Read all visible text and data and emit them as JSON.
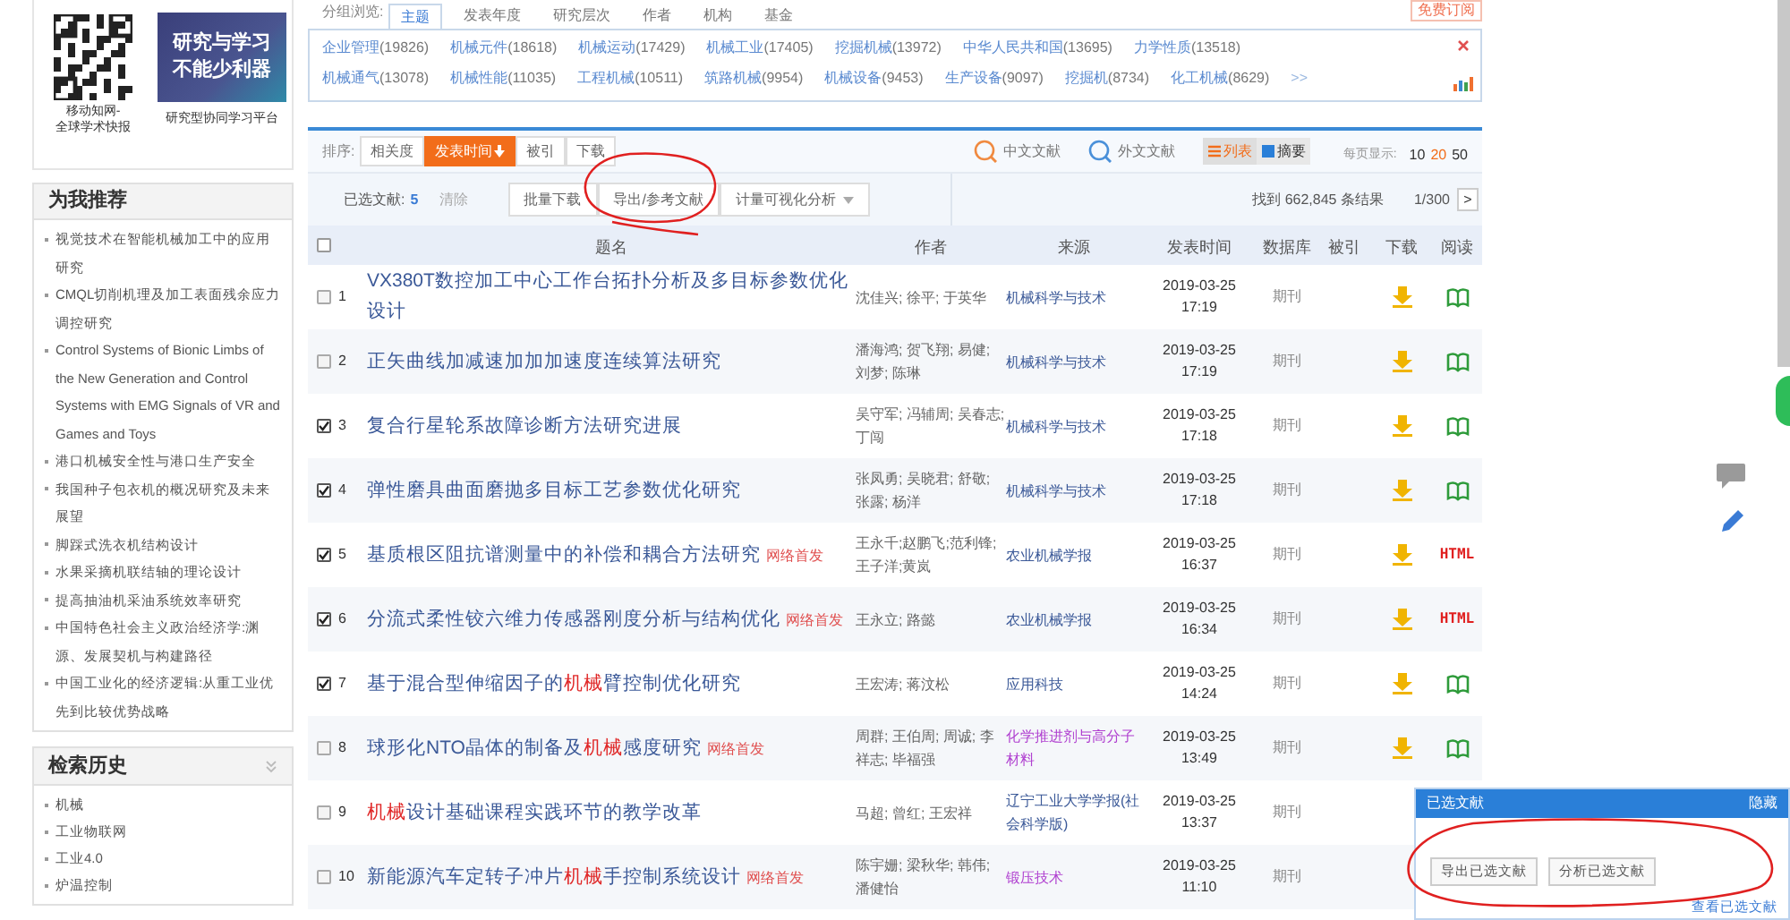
{
  "promo": {
    "qr_caption": "移动知网-\n全球学术快报",
    "banner_lines": [
      "研究与学习",
      "不能少利器"
    ],
    "banner_caption": "研究型协同学习平台"
  },
  "group_browse": {
    "label": "分组浏览:",
    "tabs": [
      {
        "label": "主题",
        "selected": true
      },
      {
        "label": "发表年度",
        "selected": false
      },
      {
        "label": "研究层次",
        "selected": false
      },
      {
        "label": "作者",
        "selected": false
      },
      {
        "label": "机构",
        "selected": false
      },
      {
        "label": "基金",
        "selected": false
      }
    ],
    "subscribe": "免费订阅",
    "more": ">>",
    "topic_rows": [
      [
        {
          "name": "企业管理",
          "count": "(19826)"
        },
        {
          "name": "机械元件",
          "count": "(18618)"
        },
        {
          "name": "机械运动",
          "count": "(17429)"
        },
        {
          "name": "机械工业",
          "count": "(17405)"
        },
        {
          "name": "挖掘机械",
          "count": "(13972)"
        },
        {
          "name": "中华人民共和国",
          "count": "(13695)"
        },
        {
          "name": "力学性质",
          "count": "(13518)"
        }
      ],
      [
        {
          "name": "机械通气",
          "count": "(13078)"
        },
        {
          "name": "机械性能",
          "count": "(11035)"
        },
        {
          "name": "工程机械",
          "count": "(10511)"
        },
        {
          "name": "筑路机械",
          "count": "(9954)"
        },
        {
          "name": "机械设备",
          "count": "(9453)"
        },
        {
          "name": "生产设备",
          "count": "(9097)"
        },
        {
          "name": "挖掘机",
          "count": "(8734)"
        },
        {
          "name": "化工机械",
          "count": "(8629)"
        }
      ]
    ]
  },
  "sidebar": {
    "recommend": {
      "title": "为我推荐",
      "items": [
        "视觉技术在智能机械加工中的应用研究",
        "CMQL切削机理及加工表面残余应力调控研究",
        "Control Systems of Bionic Limbs of the New Generation and Control Systems with EMG Signals of VR and Games and Toys",
        "港口机械安全性与港口生产安全",
        "我国种子包衣机的概况研究及未来展望",
        "脚踩式洗衣机结构设计",
        "水果采摘机联结轴的理论设计",
        "提高抽油机采油系统效率研究",
        "中国特色社会主义政治经济学:渊源、发展契机与构建路径",
        "中国工业化的经济逻辑:从重工业优先到比较优势战略"
      ]
    },
    "history": {
      "title": "检索历史",
      "expanded": false,
      "items": [
        "机械",
        "工业物联网",
        "工业4.0",
        "炉温控制"
      ]
    }
  },
  "sort_bar": {
    "label": "排序:",
    "options": [
      {
        "label": "相关度",
        "selected": false
      },
      {
        "label": "发表时间",
        "selected": true
      },
      {
        "label": "被引",
        "selected": false
      },
      {
        "label": "下载",
        "selected": false
      }
    ],
    "chinese": "中文文献",
    "foreign": "外文文献",
    "views": [
      {
        "label": "列表",
        "selected": true
      },
      {
        "label": "摘要",
        "selected": false
      }
    ],
    "per_page_label": "每页显示:",
    "per_page": [
      {
        "label": "10",
        "selected": false
      },
      {
        "label": "20",
        "selected": true
      },
      {
        "label": "50",
        "selected": false
      }
    ]
  },
  "selection_bar": {
    "label": "已选文献:",
    "count": "5",
    "clear": "清除",
    "buttons": [
      "批量下载",
      "导出/参考文献",
      "计量可视化分析"
    ],
    "result": "找到 662,845 条结果",
    "page": "1/300",
    "next": ">"
  },
  "table": {
    "all_selected": false,
    "columns": [
      "题名",
      "作者",
      "来源",
      "发表时间",
      "数据库",
      "被引",
      "下载",
      "阅读"
    ],
    "rows": [
      {
        "checked": false,
        "number": "1",
        "title": [
          {
            "text": "VX380T数控加工中心工作台拓扑分析及多目标参数优化设计",
            "highlight": false
          }
        ],
        "authors": "沈佳兴; 徐平; 于英华",
        "source": "机械科学与技术",
        "visited": false,
        "date": "2019-03-25",
        "time": "17:19",
        "database": "期刊",
        "read": {
          "kind": "book"
        }
      },
      {
        "checked": false,
        "number": "2",
        "title": [
          {
            "text": "正矢曲线加减速加加加速度连续算法研究",
            "highlight": false
          }
        ],
        "authors": "潘海鸿; 贺飞翔; 易健; 刘梦; 陈琳",
        "source": "机械科学与技术",
        "visited": false,
        "date": "2019-03-25",
        "time": "17:19",
        "database": "期刊",
        "read": {
          "kind": "book"
        }
      },
      {
        "checked": true,
        "number": "3",
        "title": [
          {
            "text": "复合行星轮系故障诊断方法研究进展",
            "highlight": false
          }
        ],
        "authors": "吴守军; 冯辅周; 吴春志; 丁闯",
        "source": "机械科学与技术",
        "visited": false,
        "date": "2019-03-25",
        "time": "17:18",
        "database": "期刊",
        "read": {
          "kind": "book"
        }
      },
      {
        "checked": true,
        "number": "4",
        "title": [
          {
            "text": "弹性磨具曲面磨抛多目标工艺参数优化研究",
            "highlight": false
          }
        ],
        "authors": "张凤勇; 吴晓君; 舒敬; 张露; 杨洋",
        "source": "机械科学与技术",
        "visited": false,
        "date": "2019-03-25",
        "time": "17:18",
        "database": "期刊",
        "read": {
          "kind": "book"
        }
      },
      {
        "checked": true,
        "number": "5",
        "title": [
          {
            "text": "基质根区阻抗谱测量中的补偿和耦合方法研究",
            "highlight": false
          }
        ],
        "tag": "网络首发",
        "authors": "王永千;赵鹏飞;范利锋;王子洋;黄岚",
        "source": "农业机械学报",
        "visited": false,
        "date": "2019-03-25",
        "time": "16:37",
        "database": "期刊",
        "read": {
          "kind": "html",
          "label": "HTML"
        }
      },
      {
        "checked": true,
        "number": "6",
        "title": [
          {
            "text": "分流式柔性铰六维力传感器刚度分析与结构优化",
            "highlight": false
          }
        ],
        "tag": "网络首发",
        "authors": "王永立; 路懿",
        "source": "农业机械学报",
        "visited": false,
        "date": "2019-03-25",
        "time": "16:34",
        "database": "期刊",
        "read": {
          "kind": "html",
          "label": "HTML"
        }
      },
      {
        "checked": true,
        "number": "7",
        "title": [
          {
            "text": "基于混合型伸缩因子的",
            "highlight": false
          },
          {
            "text": "机械",
            "highlight": true
          },
          {
            "text": "臂控制优化研究",
            "highlight": false
          }
        ],
        "authors": "王宏涛; 蒋汶松",
        "source": "应用科技",
        "visited": false,
        "date": "2019-03-25",
        "time": "14:24",
        "database": "期刊",
        "read": {
          "kind": "book"
        }
      },
      {
        "checked": false,
        "number": "8",
        "title": [
          {
            "text": "球形化NTO晶体的制备及",
            "highlight": false
          },
          {
            "text": "机械",
            "highlight": true
          },
          {
            "text": "感度研究",
            "highlight": false
          }
        ],
        "tag": "网络首发",
        "authors": "周群; 王伯周; 周诚; 李祥志; 毕福强",
        "source": "化学推进剂与高分子材料",
        "visited": true,
        "date": "2019-03-25",
        "time": "13:49",
        "database": "期刊",
        "read": {
          "kind": "book"
        }
      },
      {
        "checked": false,
        "number": "9",
        "title": [
          {
            "text": "机械",
            "highlight": true
          },
          {
            "text": "设计基础课程实践环节的教学改革",
            "highlight": false
          }
        ],
        "authors": "马超; 曾红; 王宏祥",
        "source": "辽宁工业大学学报(社会科学版)",
        "visited": false,
        "date": "2019-03-25",
        "time": "13:37",
        "database": "期刊"
      },
      {
        "checked": false,
        "number": "10",
        "title": [
          {
            "text": "新能源汽车定转子冲片",
            "highlight": false
          },
          {
            "text": "机械",
            "highlight": true
          },
          {
            "text": "手控制系统设计",
            "highlight": false
          }
        ],
        "tag": "网络首发",
        "authors": "陈宇姗; 梁秋华; 韩伟; 潘健怡",
        "source": "锻压技术",
        "visited": true,
        "date": "2019-03-25",
        "time": "11:10",
        "database": "期刊"
      }
    ]
  },
  "selected_panel": {
    "title": "已选文献",
    "hide": "隐藏",
    "buttons": [
      "导出已选文献",
      "分析已选文献"
    ],
    "link": "查看已选文献"
  }
}
